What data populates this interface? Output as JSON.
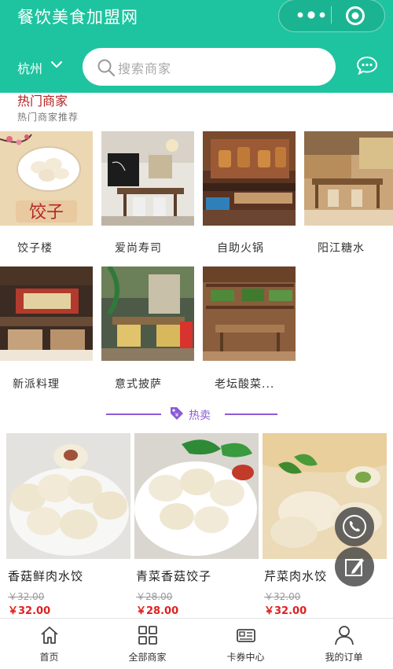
{
  "app": {
    "title": "餐饮美食加盟网"
  },
  "header": {
    "city": "杭州",
    "search_placeholder": "搜索商家"
  },
  "section_hot_shops": {
    "title": "热门商家",
    "subtitle": "热门商家推荐",
    "shops": [
      {
        "name": "饺子楼"
      },
      {
        "name": "爱尚寿司"
      },
      {
        "name": "自助火锅"
      },
      {
        "name": "阳江糖水"
      },
      {
        "name": "新派料理"
      },
      {
        "name": "意式披萨"
      },
      {
        "name": "老坛酸菜..."
      }
    ],
    "dumpling_sign": "饺子"
  },
  "section_hot_sale": {
    "label": "热卖",
    "products": [
      {
        "name": "香菇鲜肉水饺",
        "old_price": "￥32.00",
        "price": "￥32.00"
      },
      {
        "name": "青菜香菇饺子",
        "old_price": "￥28.00",
        "price": "￥28.00"
      },
      {
        "name": "芹菜肉水饺",
        "old_price": "￥32.00",
        "price": "￥32.00"
      }
    ]
  },
  "tabbar": [
    {
      "label": "首页",
      "icon": "home-icon"
    },
    {
      "label": "全部商家",
      "icon": "grid-icon"
    },
    {
      "label": "卡券中心",
      "icon": "card-icon"
    },
    {
      "label": "我的订单",
      "icon": "user-icon"
    }
  ],
  "colors": {
    "brand": "#1ec49f",
    "accent": "#8a5bd8",
    "price": "#e02020",
    "section_title": "#b32020"
  }
}
